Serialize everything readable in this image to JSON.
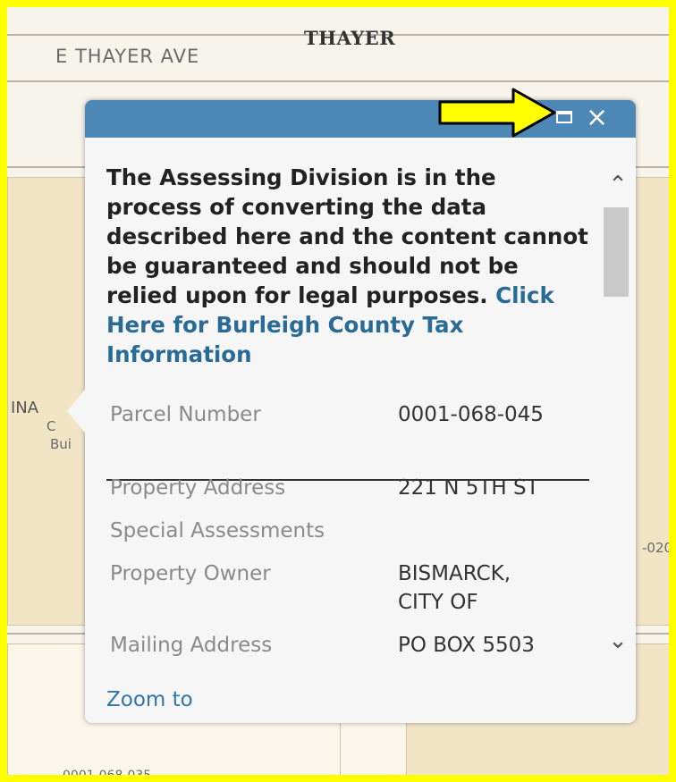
{
  "map": {
    "street_label_small": "E THAYER AVE",
    "street_label_bold": "THAYER",
    "parcel_label_bottom": "0001-068-035",
    "parcel_label_left_1": "INA",
    "parcel_label_left_2": "C",
    "parcel_label_left_3": "Bui",
    "parcel_label_right": "-020"
  },
  "popup": {
    "notice_text": "The Assessing Division is in the process of converting the data described here and the content cannot be guaranteed and should not be relied upon for legal purposes.",
    "notice_link": "Click Here for Burleigh County Tax Information",
    "fields": [
      {
        "label": "Parcel Number",
        "value": "0001-068-045"
      },
      {
        "label": "Property Address",
        "value": "221 N 5TH ST"
      },
      {
        "label": "Special Assessments",
        "value": ""
      },
      {
        "label": "Property Owner",
        "value": "BISMARCK, CITY OF"
      },
      {
        "label": "Mailing Address",
        "value": "PO BOX 5503"
      }
    ],
    "zoom_link": "Zoom to",
    "maximize_icon": "maximize-icon",
    "close_icon": "close-icon"
  },
  "colors": {
    "highlight_border": "#ffff00",
    "popup_header": "#4d87b5",
    "link": "#2a6b96",
    "arrow_fill": "#ffff00"
  }
}
